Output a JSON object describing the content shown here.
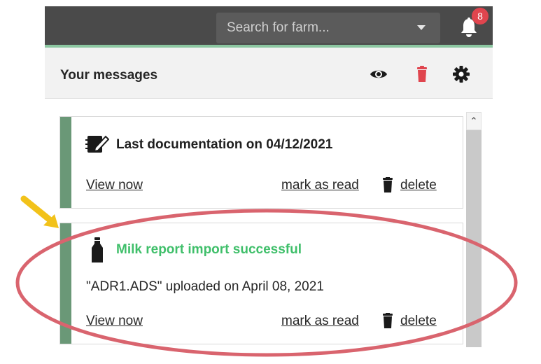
{
  "header": {
    "search": {
      "placeholder": "Search for farm..."
    },
    "notifications": {
      "count": "8"
    }
  },
  "messages_panel": {
    "title": "Your messages",
    "actions": [
      "eye-icon",
      "trash-icon",
      "gear-icon"
    ]
  },
  "messages": [
    {
      "icon": "edit-document-icon",
      "title": "Last documentation on 04/12/2021",
      "body": "",
      "view_label": "View now",
      "mark_label": "mark as read",
      "delete_label": "delete"
    },
    {
      "icon": "milk-bottle-icon",
      "title": "Milk report import successful",
      "body": "\"ADR1.ADS\" uploaded on April 08, 2021",
      "view_label": "View now",
      "mark_label": "mark as read",
      "delete_label": "delete"
    }
  ],
  "colors": {
    "topbar": "#4a4a4a",
    "accent": "#8cc7a1",
    "stripe": "#6a9877",
    "success_title": "#3fbf6a",
    "delete_red": "#e0454e",
    "annotation_ellipse": "#d9646e",
    "annotation_arrow": "#f2c21a"
  }
}
